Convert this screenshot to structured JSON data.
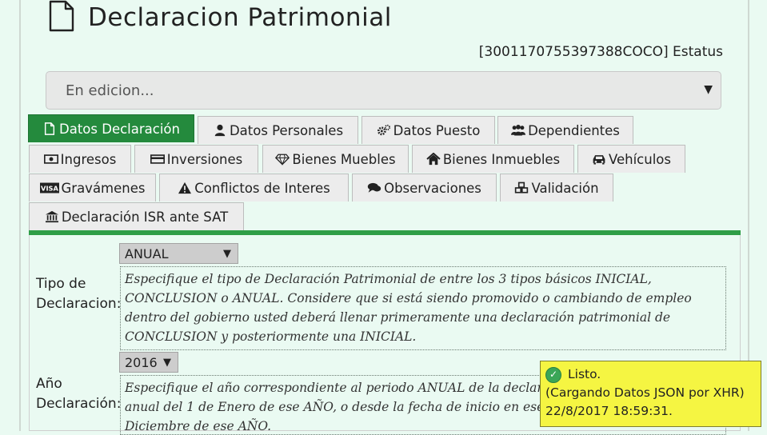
{
  "page": {
    "title": "Declaracion Patrimonial",
    "status_line": "[3001170755397388COCO] Estatus"
  },
  "status_select": {
    "value": "En edicion..."
  },
  "tabs": [
    {
      "label": "Datos Declaración",
      "icon": "document-icon",
      "active": true
    },
    {
      "label": "Datos Personales",
      "icon": "user-icon"
    },
    {
      "label": "Datos Puesto",
      "icon": "cogs-icon"
    },
    {
      "label": "Dependientes",
      "icon": "users-icon"
    },
    {
      "label": "Ingresos",
      "icon": "money-icon"
    },
    {
      "label": "Inversiones",
      "icon": "credit-card-icon"
    },
    {
      "label": "Bienes Muebles",
      "icon": "diamond-icon"
    },
    {
      "label": "Bienes Inmuebles",
      "icon": "home-icon"
    },
    {
      "label": "Vehículos",
      "icon": "car-icon"
    },
    {
      "label": "Gravámenes",
      "icon": "visa-icon"
    },
    {
      "label": "Conflictos de Interes",
      "icon": "warning-icon"
    },
    {
      "label": "Observaciones",
      "icon": "comments-icon"
    },
    {
      "label": "Validación",
      "icon": "cubes-icon"
    },
    {
      "label": "Declaración ISR ante SAT",
      "icon": "bank-icon"
    }
  ],
  "form": {
    "tipo": {
      "label_line1": "Tipo de",
      "label_line2": "Declaracion:",
      "selected": "ANUAL",
      "help": "Especifique el tipo de Declaración Patrimonial de entre los 3 tipos básicos INICIAL, CONCLUSION o ANUAL. Considere que si está siendo promovido o cambiando de empleo dentro del gobierno usted deberá llenar primeramente una declaración patrimonial de CONCLUSION y posteriormente una INICIAL."
    },
    "anio": {
      "label_line1": "Año",
      "label_line2": "Declaración:",
      "selected": "2016",
      "help": "Especifique el año correspondiente al periodo ANUAL de la declaración. Refiere al periodo anual del 1 de Enero de ese AÑO, o desde la fecha de inicio en ese AÑO, a la fecha del 31 de Diciembre de ese AÑO."
    }
  },
  "toast": {
    "line1": "Listo.",
    "line2": "(Cargando Datos JSON por XHR)",
    "line3": "22/8/2017 18:59:31."
  }
}
